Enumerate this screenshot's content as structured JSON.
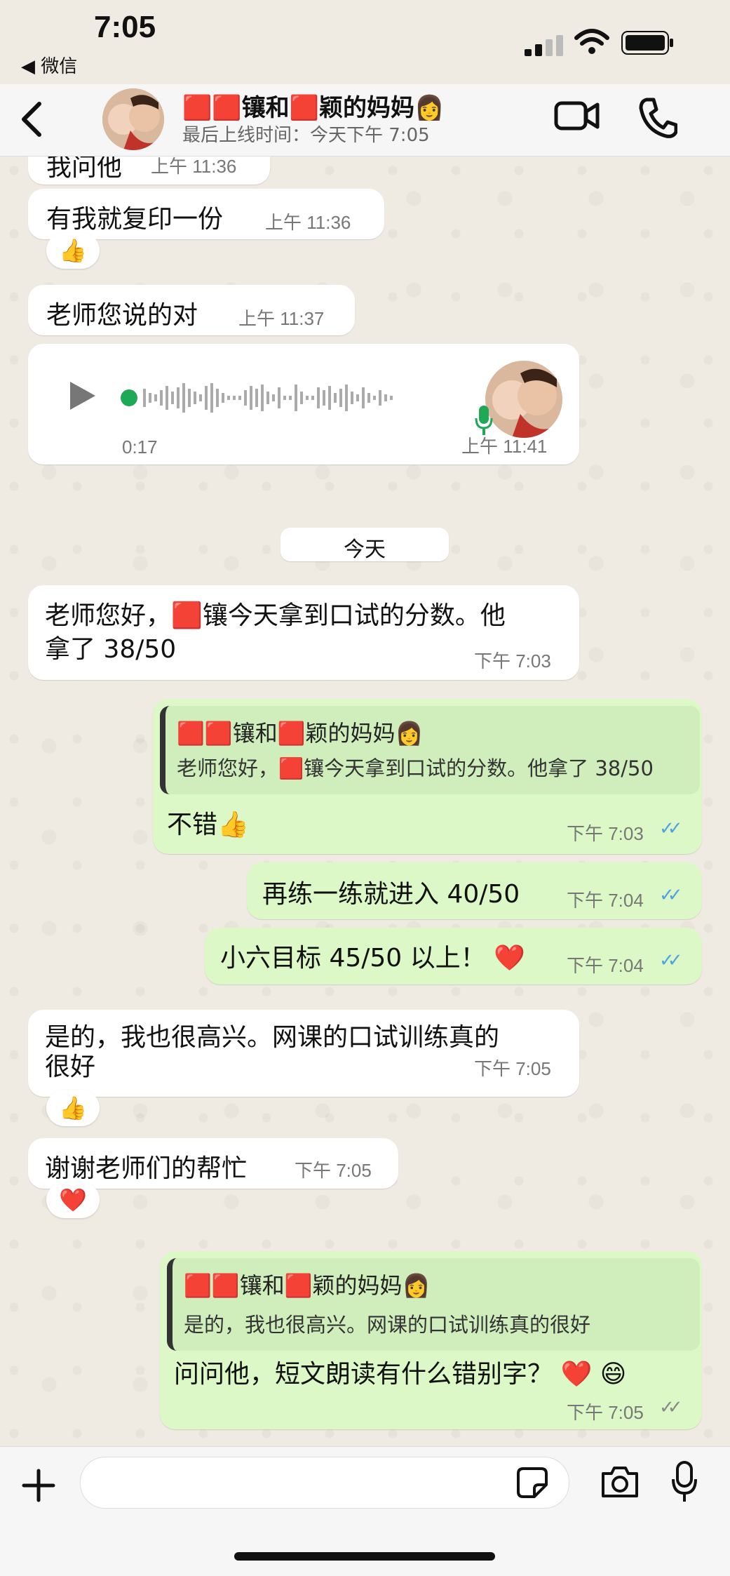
{
  "status_bar": {
    "time": "7:05",
    "back_app": "◀ 微信"
  },
  "header": {
    "contact_name": "🟥🟥镶和🟥颖的妈妈👩",
    "last_seen": "最后上线时间：今天下午 7:05"
  },
  "messages": [
    {
      "text": "我问他",
      "time": "上午 11:36"
    },
    {
      "text": "有我就复印一份",
      "time": "上午 11:36",
      "reaction": "👍"
    },
    {
      "text": "老师您说的对",
      "time": "上午 11:37"
    },
    {
      "voice_duration": "0:17",
      "time": "上午 11:41"
    },
    {
      "date_divider": "今天"
    },
    {
      "text_line1": "老师您好，🟥镶今天拿到口试的分数。他",
      "text_line2": "拿了 38/50",
      "time": "下午 7:03"
    },
    {
      "quote_name": "🟥🟥镶和🟥颖的妈妈👩",
      "quote_text": "老师您好，🟥镶今天拿到口试的分数。他拿了 38/50",
      "text": "不错👍",
      "time": "下午 7:03"
    },
    {
      "text": "再练一练就进入 40/50",
      "time": "下午 7:04"
    },
    {
      "text": "小六目标 45/50 以上！ ❤️",
      "time": "下午 7:04"
    },
    {
      "text_line1": "是的，我也很高兴。网课的口试训练真的",
      "text_line2": "很好",
      "time": "下午 7:05",
      "reaction": "👍"
    },
    {
      "text": "谢谢老师们的帮忙",
      "time": "下午 7:05",
      "reaction": "❤️"
    },
    {
      "quote_name": "🟥🟥镶和🟥颖的妈妈👩",
      "quote_text": "是的，我也很高兴。网课的口试训练真的很好",
      "text": "问问他，短文朗读有什么错别字？ ❤️ 😄",
      "time": "下午 7:05"
    }
  ],
  "colors": {
    "outgoing": "#dcf8c6",
    "incoming": "#ffffff",
    "read_ticks": "#4fa3e3"
  }
}
